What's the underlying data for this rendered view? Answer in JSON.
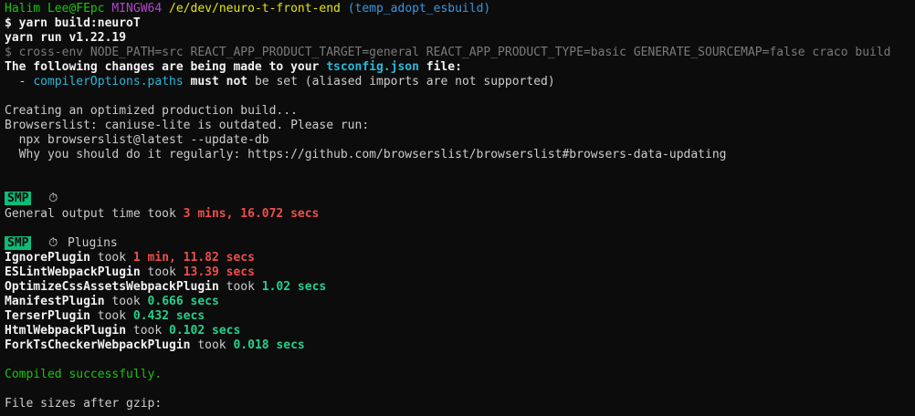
{
  "prompt": {
    "user_host": "Halim Lee@FEpc",
    "shell": "MINGW64",
    "path": "/e/dev/neuro-t-front-end",
    "branch": "(temp_adopt_esbuild)",
    "symbol": "$",
    "command": "yarn build:neuroT"
  },
  "yarn_version": "yarn run v1.22.19",
  "script_cmd": "$ cross-env NODE_PATH=src REACT_APP_PRODUCT_TARGET=general REACT_APP_PRODUCT_TYPE=basic GENERATE_SOURCEMAP=false craco build",
  "tsconfig": {
    "prefix": "The following changes are being made to your ",
    "file": "tsconfig.json",
    "suffix": " file:",
    "bullet": "  - ",
    "option": "compilerOptions.paths",
    "must_not": " must not",
    "rest": " be set (aliased imports are not supported)"
  },
  "build": {
    "creating": "Creating an optimized production build...",
    "browserslist_warn": "Browserslist: caniuse-lite is outdated. Please run:",
    "npx_cmd": "  npx browserslist@latest --update-db",
    "why": "  Why you should do it regularly: https://github.com/browserslist/browserslist#browsers-data-updating"
  },
  "smp": {
    "badge": "SMP",
    "stopwatch_glyph": "⏱",
    "general_label": "General output time took ",
    "general_time": "3 mins, 16.072 secs",
    "plugins_label": "Plugins",
    "took": " took ",
    "plugins": [
      {
        "name": "IgnorePlugin",
        "time": "1 min, 11.82 secs",
        "color": "#f14c4c"
      },
      {
        "name": "ESLintWebpackPlugin",
        "time": "13.39 secs",
        "color": "#f14c4c"
      },
      {
        "name": "OptimizeCssAssetsWebpackPlugin",
        "time": "1.02 secs",
        "color": "#23d18b"
      },
      {
        "name": "ManifestPlugin",
        "time": "0.666 secs",
        "color": "#23d18b"
      },
      {
        "name": "TerserPlugin",
        "time": "0.432 secs",
        "color": "#23d18b"
      },
      {
        "name": "HtmlWebpackPlugin",
        "time": "0.102 secs",
        "color": "#23d18b"
      },
      {
        "name": "ForkTsCheckerWebpackPlugin",
        "time": "0.018 secs",
        "color": "#23d18b"
      }
    ]
  },
  "result": {
    "compiled": "Compiled successfully.",
    "file_sizes": "File sizes after gzip:"
  },
  "colors": {
    "background": "#0c0c0c",
    "prompt_green": "#16c60c",
    "prompt_magenta": "#b148c6",
    "path_yellow": "#e5e510",
    "branch_cyan": "#3a96dd",
    "slow_red": "#f14c4c",
    "fast_green": "#23d18b",
    "badge_green": "#0dbc79"
  }
}
